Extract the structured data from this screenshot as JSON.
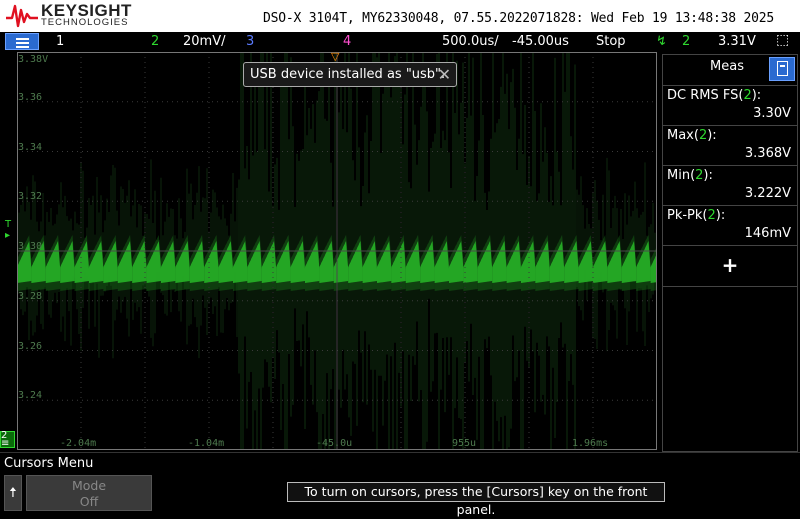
{
  "header": {
    "brand": "KEYSIGHT",
    "brand_sub": "TECHNOLOGIES",
    "model_info": "DSO-X 3104T, MY62330048, 07.55.2022071828: Wed Feb 19 13:48:38 2025"
  },
  "statusbar": {
    "ch1": "1",
    "ch2": "2",
    "ch2_scale": "20mV/",
    "ch3": "3",
    "ch4": "4",
    "timebase": "500.0us/",
    "delay": "-45.00us",
    "run_state": "Stop",
    "trigger_channel": "2",
    "trigger_level": "3.31V",
    "colors": {
      "ch1": "#ffffff",
      "ch2": "#2fd82f",
      "ch3": "#5b7bff",
      "ch4": "#ff4fd0",
      "stop": "#ffffff"
    }
  },
  "toast": {
    "message": "USB device installed as \"usb\".",
    "close_icon": "close-icon"
  },
  "y_axis_labels": [
    "3.38V",
    "3.36",
    "3.34",
    "3.32",
    "3.30",
    "3.28",
    "3.26",
    "3.24"
  ],
  "x_axis_labels": [
    "-2.04m",
    "-1.04m",
    "-45.0u",
    "955u",
    "1.96ms"
  ],
  "measurements": {
    "title": "Meas",
    "items": [
      {
        "label": "DC RMS FS(",
        "channel": "2",
        "suffix": "):",
        "value": "3.30V"
      },
      {
        "label": "Max(",
        "channel": "2",
        "suffix": "):",
        "value": "3.368V"
      },
      {
        "label": "Min(",
        "channel": "2",
        "suffix": "):",
        "value": "3.222V"
      },
      {
        "label": "Pk-Pk(",
        "channel": "2",
        "suffix": "):",
        "value": "146mV"
      }
    ],
    "add_label": "+"
  },
  "bottom": {
    "menu_title": "Cursors Menu",
    "mode_label": "Mode",
    "mode_value": "Off",
    "hint": "To turn on cursors, press the [Cursors] key on the front panel."
  },
  "markers": {
    "channel_ground": "2",
    "trigger": "T"
  }
}
